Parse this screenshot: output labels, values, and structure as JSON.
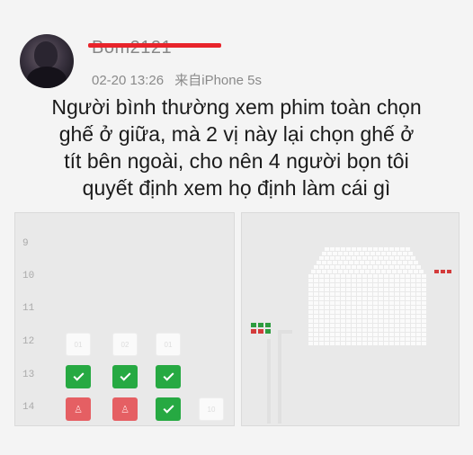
{
  "post": {
    "username": "Bom2121",
    "timestamp": "02-20 13:26",
    "source": "来自iPhone 5s",
    "text_lines": [
      "Người bình thường xem phim toàn chọn",
      "ghế ở giữa, mà 2 vị này lại chọn ghế ở",
      "tít bên ngoài, cho nên 4 người bọn tôi",
      "quyết định xem họ định làm cái gì"
    ]
  },
  "left_screenshot": {
    "row_numbers": [
      "9",
      "10",
      "11",
      "12",
      "13",
      "14"
    ],
    "seat_rows": [
      {
        "row": "12",
        "seats": [
          {
            "state": "empty",
            "label": "01"
          },
          {
            "state": "empty",
            "label": "02"
          },
          {
            "state": "empty",
            "label": "01"
          }
        ]
      },
      {
        "row": "13",
        "seats": [
          {
            "state": "selected"
          },
          {
            "state": "selected"
          },
          {
            "state": "selected"
          }
        ]
      },
      {
        "row": "14",
        "seats": [
          {
            "state": "sold"
          },
          {
            "state": "sold"
          },
          {
            "state": "selected"
          },
          {
            "state": "empty",
            "label": "10"
          }
        ]
      }
    ]
  },
  "right_screenshot": {
    "mini_selected_count": 3,
    "mini_sold_count": 3
  },
  "colors": {
    "selected": "#26a942",
    "sold": "#e55f63",
    "strike": "#e8242b"
  }
}
